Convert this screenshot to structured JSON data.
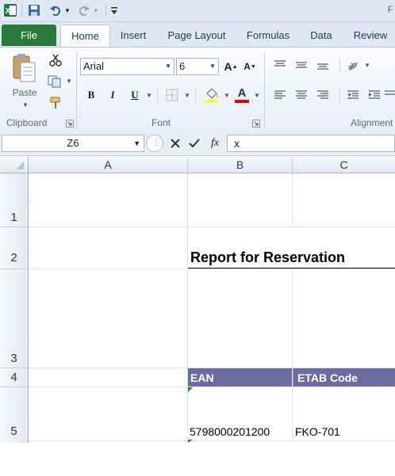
{
  "qat": {
    "window_title_fragment": "F"
  },
  "tabs": [
    "File",
    "Home",
    "Insert",
    "Page Layout",
    "Formulas",
    "Data",
    "Review"
  ],
  "ribbon": {
    "clipboard": {
      "paste_label": "Paste",
      "group_label": "Clipboard"
    },
    "font": {
      "font_name": "Arial",
      "font_size": "6",
      "group_label": "Font",
      "bold": "B",
      "italic": "I",
      "underline": "U",
      "font_color": "#e00000"
    },
    "alignment": {
      "group_label": "Alignment"
    }
  },
  "formula_bar": {
    "name_box": "Z6",
    "fx_label": "fx",
    "formula": "x"
  },
  "sheet": {
    "columns": [
      "A",
      "B",
      "C"
    ],
    "rows": [
      "1",
      "2",
      "3",
      "4",
      "5"
    ],
    "title": "Report for Reservation",
    "headers": [
      "EAN",
      "ETAB Code"
    ],
    "header_color": "#6b6ba0",
    "row5": {
      "ean": "5798000201200",
      "etab": "FKO-701"
    }
  }
}
